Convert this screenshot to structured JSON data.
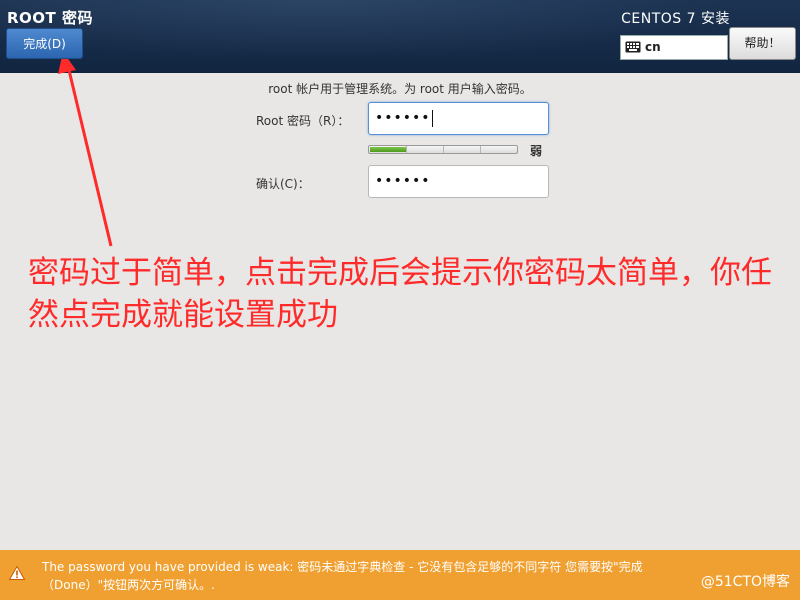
{
  "header": {
    "title": "ROOT 密码",
    "done_label": "完成(D)",
    "product": "CENTOS 7 安装",
    "keyboard_layout": "cn",
    "help_label": "帮助！"
  },
  "form": {
    "info": "root 帐户用于管理系统。为 root 用户输入密码。",
    "root_label": "Root 密码（R）：",
    "root_value": "••••••",
    "confirm_label": "确认(C)：",
    "confirm_value": "••••••",
    "strength_fraction": 0.25,
    "strength_text": "弱",
    "strength_color": "#5fb130"
  },
  "annotation": {
    "text": "密码过于简单，点击完成后会提示你密码太简单，你任然点完成就能设置成功",
    "color": "#ff2a2a"
  },
  "warning": {
    "text": "The password you have provided is weak: 密码未通过字典检查 - 它没有包含足够的不同字符 您需要按\"完成（Done）\"按钮两次方可确认。.",
    "color": "#f0a030"
  },
  "watermark": "@51CTO博客",
  "icons": {
    "keyboard": "keyboard-icon",
    "warning": "warning-icon"
  }
}
